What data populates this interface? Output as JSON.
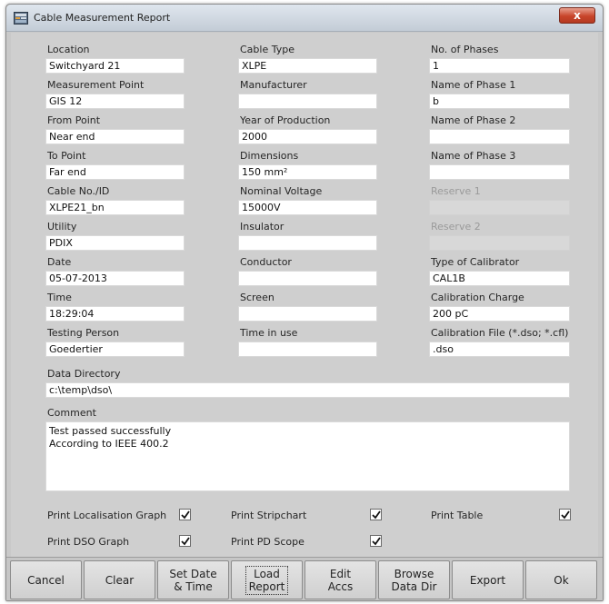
{
  "window": {
    "title": "Cable Measurement Report",
    "close_label": "x"
  },
  "fields": {
    "location": {
      "label": "Location",
      "value": "Switchyard 21"
    },
    "measurement_point": {
      "label": "Measurement Point",
      "value": "GIS 12"
    },
    "from_point": {
      "label": "From Point",
      "value": "Near end"
    },
    "to_point": {
      "label": "To Point",
      "value": "Far end"
    },
    "cable_no": {
      "label": "Cable No./ID",
      "value": "XLPE21_bn"
    },
    "utility": {
      "label": "Utility",
      "value": "PDIX"
    },
    "date": {
      "label": "Date",
      "value": "05-07-2013"
    },
    "time": {
      "label": "Time",
      "value": "18:29:04"
    },
    "testing_person": {
      "label": "Testing Person",
      "value": "Goedertier"
    },
    "cable_type": {
      "label": "Cable Type",
      "value": "XLPE"
    },
    "manufacturer": {
      "label": "Manufacturer",
      "value": ""
    },
    "year_of_production": {
      "label": "Year of Production",
      "value": "2000"
    },
    "dimensions": {
      "label": "Dimensions",
      "value": "150 mm²"
    },
    "nominal_voltage": {
      "label": "Nominal Voltage",
      "value": "15000V"
    },
    "insulator": {
      "label": "Insulator",
      "value": ""
    },
    "conductor": {
      "label": "Conductor",
      "value": ""
    },
    "screen": {
      "label": "Screen",
      "value": ""
    },
    "time_in_use": {
      "label": "Time in use",
      "value": ""
    },
    "no_of_phases": {
      "label": "No. of Phases",
      "value": "1"
    },
    "name_phase_1": {
      "label": "Name of Phase 1",
      "value": "b"
    },
    "name_phase_2": {
      "label": "Name of Phase 2",
      "value": ""
    },
    "name_phase_3": {
      "label": "Name of Phase 3",
      "value": ""
    },
    "reserve_1": {
      "label": "Reserve 1",
      "value": ""
    },
    "reserve_2": {
      "label": "Reserve 2",
      "value": ""
    },
    "type_of_calibrator": {
      "label": "Type of Calibrator",
      "value": "CAL1B"
    },
    "calibration_charge": {
      "label": "Calibration Charge",
      "value": "200 pC"
    },
    "calibration_file": {
      "label": "Calibration File (*.dso; *.cfl)",
      "value": ".dso"
    },
    "data_directory": {
      "label": "Data Directory",
      "value": "c:\\temp\\dso\\"
    }
  },
  "comment": {
    "label": "Comment",
    "lines": [
      "Test passed successfully",
      "According to IEEE 400.2"
    ]
  },
  "checkboxes": {
    "print_localisation_graph": {
      "label": "Print Localisation Graph",
      "checked": true
    },
    "print_dso_graph": {
      "label": "Print DSO Graph",
      "checked": true
    },
    "print_stripchart": {
      "label": "Print Stripchart",
      "checked": true
    },
    "print_pd_scope": {
      "label": "Print PD Scope",
      "checked": true
    },
    "print_table": {
      "label": "Print Table",
      "checked": true
    }
  },
  "buttons": {
    "cancel": "Cancel",
    "clear": "Clear",
    "set_date_time": "Set Date\n& Time",
    "load_report": "Load\nReport",
    "edit_accs": "Edit\nAccs",
    "browse_data_dir": "Browse\nData Dir",
    "export": "Export",
    "ok": "Ok"
  }
}
